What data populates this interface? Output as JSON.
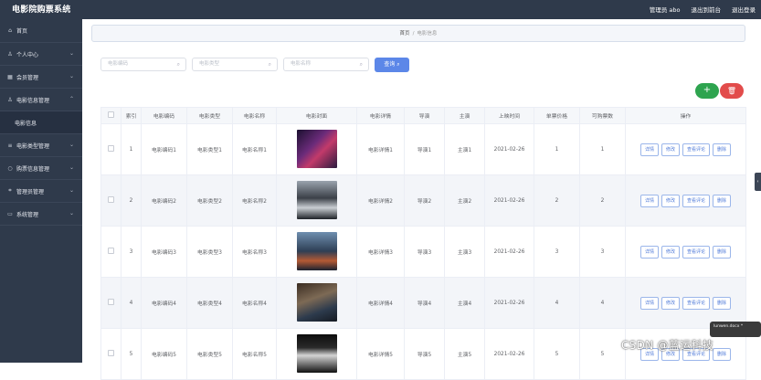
{
  "header": {
    "app_title": "电影院购票系统",
    "admin_label": "管理员 abo",
    "back_label": "退出到前台",
    "logout_label": "退出登录"
  },
  "sidebar": {
    "items": [
      {
        "label": "首页",
        "icon": "home-icon",
        "chevron": false
      },
      {
        "label": "个人中心",
        "icon": "user-icon",
        "chevron": true
      },
      {
        "label": "会员管理",
        "icon": "grid-icon",
        "chevron": true
      },
      {
        "label": "电影信息管理",
        "icon": "user-icon",
        "chevron": true
      },
      {
        "label": "电影信息",
        "icon": "",
        "chevron": false,
        "sub": true
      },
      {
        "label": "电影类型管理",
        "icon": "list-icon",
        "chevron": true
      },
      {
        "label": "购票信息管理",
        "icon": "circle-icon",
        "chevron": true
      },
      {
        "label": "管理员管理",
        "icon": "bracket-icon",
        "chevron": true
      },
      {
        "label": "系统管理",
        "icon": "folder-icon",
        "chevron": true
      }
    ]
  },
  "breadcrumb": {
    "home": "首页",
    "sep": "/",
    "current": "电影信息"
  },
  "search": {
    "code_placeholder": "电影编码",
    "type_placeholder": "电影类型",
    "name_placeholder": "电影名称",
    "query_label": "查询 ⌕"
  },
  "toolbar": {
    "add_label": "+",
    "delete_label": "🗑"
  },
  "table": {
    "headers": [
      "索引",
      "电影编码",
      "电影类型",
      "电影名称",
      "电影封面",
      "电影详情",
      "导演",
      "主演",
      "上映时间",
      "单票价格",
      "可购票数",
      "操作"
    ],
    "rows": [
      {
        "idx": "1",
        "code": "电影编码1",
        "type": "电影类型1",
        "name": "电影名称1",
        "detail": "电影详情1",
        "director": "导演1",
        "actor": "主演1",
        "date": "2021-02-26",
        "price": "1",
        "count": "1"
      },
      {
        "idx": "2",
        "code": "电影编码2",
        "type": "电影类型2",
        "name": "电影名称2",
        "detail": "电影详情2",
        "director": "导演2",
        "actor": "主演2",
        "date": "2021-02-26",
        "price": "2",
        "count": "2"
      },
      {
        "idx": "3",
        "code": "电影编码3",
        "type": "电影类型3",
        "name": "电影名称3",
        "detail": "电影详情3",
        "director": "导演3",
        "actor": "主演3",
        "date": "2021-02-26",
        "price": "3",
        "count": "3"
      },
      {
        "idx": "4",
        "code": "电影编码4",
        "type": "电影类型4",
        "name": "电影名称4",
        "detail": "电影详情4",
        "director": "导演4",
        "actor": "主演4",
        "date": "2021-02-26",
        "price": "4",
        "count": "4"
      },
      {
        "idx": "5",
        "code": "电影编码5",
        "type": "电影类型5",
        "name": "电影名称5",
        "detail": "电影详情5",
        "director": "导演5",
        "actor": "主演5",
        "date": "2021-02-26",
        "price": "5",
        "count": "5"
      }
    ],
    "ops": {
      "detail": "详情",
      "edit": "修改",
      "review": "查看评论",
      "delete": "删除"
    }
  },
  "toast": {
    "text": "lunwen.docx *"
  },
  "watermark": {
    "text": "CSDN @蓝运科技"
  },
  "colors": {
    "sidebar": "#2f3a4b",
    "primary": "#5c87e8",
    "add": "#2ea44f",
    "danger": "#e24c4b"
  }
}
